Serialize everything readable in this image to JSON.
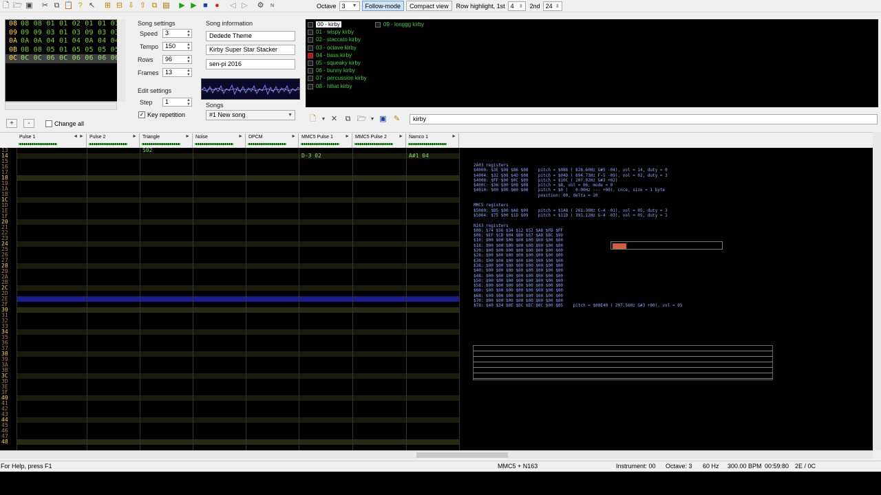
{
  "toolbar": {
    "icons": [
      "new-file-icon",
      "open-folder-icon",
      "save-icon",
      "cut-icon",
      "copy-icon",
      "paste-icon",
      "help-icon",
      "whatsthis-icon",
      "insert-frame-icon",
      "remove-frame-icon",
      "move-frame-down-icon",
      "move-frame-up-icon",
      "duplicate-frame-icon",
      "module-properties-icon",
      "play-icon",
      "play-loop-icon",
      "stop-icon",
      "record-icon",
      "prev-song-icon",
      "next-song-icon",
      "settings-icon",
      "about-icon"
    ],
    "octave_label": "Octave",
    "octave_value": "3",
    "follow_mode": "Follow-mode",
    "compact_view": "Compact view",
    "row_highlight_label": "Row highlight, 1st",
    "row_highlight_1st": "4",
    "second_label": "2nd",
    "row_highlight_2nd": "24"
  },
  "frames": {
    "rows": [
      {
        "num": "08",
        "values": "08 08 01 01 02 01 01 01"
      },
      {
        "num": "09",
        "values": "09 09 03 01 03 09 03 03"
      },
      {
        "num": "0A",
        "values": "0A 0A 04 01 04 0A 04 04"
      },
      {
        "num": "0B",
        "values": "0B 08 05 01 05 05 05 05"
      },
      {
        "num": "0C",
        "values": "0C 0C 06 0C 06 06 06 06"
      }
    ],
    "current_index": 4,
    "change_all_label": "Change all",
    "add_label": "+",
    "remove_label": "-"
  },
  "song_settings": {
    "title": "Song settings",
    "speed_label": "Speed",
    "speed": "3",
    "tempo_label": "Tempo",
    "tempo": "150",
    "rows_label": "Rows",
    "rows": "96",
    "frames_label": "Frames",
    "frames": "13"
  },
  "edit_settings": {
    "title": "Edit settings",
    "step_label": "Step",
    "step": "1",
    "key_repetition": "Key repetition"
  },
  "song_info": {
    "title": "Song information",
    "name": "Dedede Theme",
    "artist": "Kirby Super Star Stacker",
    "copyright": "sen-pi 2016",
    "songs_label": "Songs",
    "song_selected": "#1 New song"
  },
  "instruments": {
    "items": [
      {
        "label": "00 - kirby",
        "selected": true,
        "red": false
      },
      {
        "label": "01 - wispy kirby",
        "selected": false,
        "red": false
      },
      {
        "label": "02 - staccato kirby",
        "selected": false,
        "red": false
      },
      {
        "label": "03 - octave kirby",
        "selected": false,
        "red": false
      },
      {
        "label": "04 - bass kirby",
        "selected": false,
        "red": true
      },
      {
        "label": "05 - squeaky kirby",
        "selected": false,
        "red": false
      },
      {
        "label": "06 - bunny kirby",
        "selected": false,
        "red": false
      },
      {
        "label": "07 - percussion kirby",
        "selected": false,
        "red": false
      },
      {
        "label": "08 - hihat kirby",
        "selected": false,
        "red": false
      },
      {
        "label": "09 - longgg kirby",
        "selected": false,
        "red": false
      }
    ],
    "name_field": "kirby",
    "tools": [
      "new-instrument-icon",
      "dropdown-icon",
      "remove-instrument-icon",
      "clone-instrument-icon",
      "load-instrument-icon",
      "dropdown-icon",
      "save-instrument-icon",
      "edit-instrument-icon"
    ]
  },
  "channels": [
    {
      "name": "Pulse 1",
      "extra": "◄ ►"
    },
    {
      "name": "Pulse 2",
      "extra": "►"
    },
    {
      "name": "Triangle",
      "extra": "►"
    },
    {
      "name": "Noise",
      "extra": "►"
    },
    {
      "name": "DPCM",
      "extra": "►"
    },
    {
      "name": "MMC5 Pulse 1",
      "extra": "►"
    },
    {
      "name": "MMC5 Pulse 2",
      "extra": "►"
    },
    {
      "name": "Namco 1",
      "extra": "►"
    }
  ],
  "pattern": {
    "row_labels": [
      "13",
      "14",
      "15",
      "16",
      "17",
      "18",
      "19",
      "1A",
      "1B",
      "1C",
      "1D",
      "1E",
      "1F",
      "20",
      "21",
      "22",
      "23",
      "24",
      "25",
      "26",
      "27",
      "28",
      "29",
      "2A",
      "2B",
      "2C",
      "2D",
      "2E",
      "2F",
      "30",
      "31",
      "32",
      "33",
      "34",
      "35",
      "36",
      "37",
      "38",
      "39",
      "3A",
      "3B",
      "3C",
      "3D",
      "3E",
      "3F",
      "40",
      "41",
      "42",
      "43",
      "44",
      "45",
      "46",
      "47",
      "48"
    ],
    "current_row": "2E",
    "cells": [
      [
        0,
        0,
        "",
        "",
        "S02",
        "",
        "",
        "",
        "",
        ""
      ],
      [
        1,
        1,
        "",
        "",
        "",
        "",
        "",
        "D-3 02",
        "",
        "A#1 04"
      ]
    ]
  },
  "registers": {
    "text": "2A03 registers\n$4000: $3E $08 $86 $08    pitch = $086 ( 828.60Hz G#5 -04), vol = 14, duty = 0\n$4004: $32 $08 $4D $08    pitch = $04D ( 694.73Hz F-5 -09), vol = 02, duty = 3\n$4008: $FF $00 $0C $09    pitch = $10C ( 207.92Hz G#3 +02)\n$400C: $36 $00 $0B $08    pitch = $B, vol = 06, mode = 0\n$4010: $00 $00 $00 $00    pitch = $0 (   0.00Hz --- +00), cnce, size = 1 byte\n                          position: 00, delta = 20\n\nMMC5 registers\n$5000: $B5 $00 $A8 $09    pitch = $1A8 ( 261.36Hz C-4 -01), vol = 05, duty = 3\n$5004: $75 $00 $1D $09    pitch = $11D ( 391.12Hz G-4 -03), vol = 05, duty = 1\n\nN163 registers\n$00: $74 $56 $34 $12 $52 $A8 $FD $FF\n$08: $EF $CD $04 $B0 $67 $A8 $BC $99\n$10: $00 $00 $00 $00 $00 $00 $00 $00\n$18: $00 $00 $00 $00 $00 $00 $00 $00\n$20: $00 $00 $00 $00 $00 $00 $00 $00\n$28: $00 $00 $00 $00 $00 $00 $00 $00\n$30: $00 $00 $00 $00 $00 $00 $00 $00\n$38: $00 $00 $00 $00 $00 $00 $00 $00\n$40: $00 $00 $00 $00 $00 $00 $00 $00\n$48: $00 $00 $00 $00 $00 $00 $00 $00\n$50: $00 $00 $00 $00 $00 $00 $00 $00\n$58: $00 $00 $00 $00 $00 $00 $00 $00\n$60: $00 $00 $00 $00 $00 $00 $00 $00\n$68: $00 $00 $00 $00 $00 $00 $00 $00\n$70: $00 $00 $00 $00 $00 $00 $00 $00\n$78: $40 $34 $0E $0C $EC $0C $00 $05    pitch = $00E40 ( 207.56Hz G#3 +00), vol = 05"
  },
  "status": {
    "help": "For Help, press F1",
    "chips": "MMC5 + N163",
    "instrument": "Instrument: 00",
    "octave": "Octave: 3",
    "rate": "60 Hz",
    "bpm": "300.00 BPM",
    "time": "00:59:80",
    "position": "2E / 0C"
  }
}
